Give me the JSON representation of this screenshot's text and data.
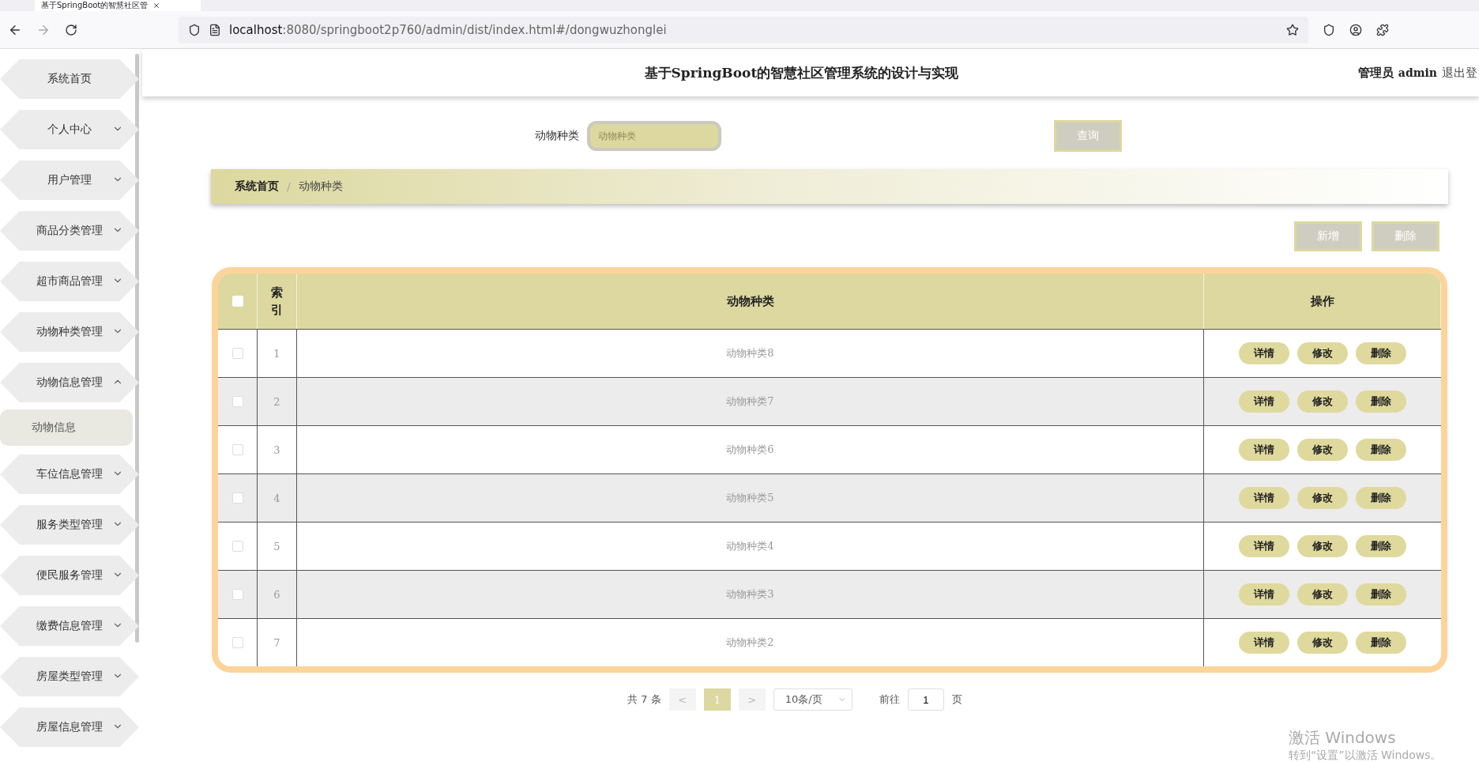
{
  "browser": {
    "tab_title": "基于SpringBoot的智慧社区管",
    "url_host": "localhost",
    "url_path": ":8080/springboot2p760/admin/dist/index.html#/dongwuzhonglei"
  },
  "sidebar": {
    "items": [
      {
        "label": "系统首页",
        "kind": "link"
      },
      {
        "label": "个人中心",
        "kind": "menu",
        "expanded": false
      },
      {
        "label": "用户管理",
        "kind": "menu",
        "expanded": false
      },
      {
        "label": "商品分类管理",
        "kind": "menu",
        "expanded": false
      },
      {
        "label": "超市商品管理",
        "kind": "menu",
        "expanded": false
      },
      {
        "label": "动物种类管理",
        "kind": "menu",
        "expanded": false
      },
      {
        "label": "动物信息管理",
        "kind": "menu",
        "expanded": true,
        "children": [
          {
            "label": "动物信息",
            "selected": true
          }
        ]
      },
      {
        "label": "车位信息管理",
        "kind": "menu",
        "expanded": false
      },
      {
        "label": "服务类型管理",
        "kind": "menu",
        "expanded": false
      },
      {
        "label": "便民服务管理",
        "kind": "menu",
        "expanded": false
      },
      {
        "label": "缴费信息管理",
        "kind": "menu",
        "expanded": false
      },
      {
        "label": "房屋类型管理",
        "kind": "menu",
        "expanded": false
      },
      {
        "label": "房屋信息管理",
        "kind": "menu",
        "expanded": false
      }
    ]
  },
  "header": {
    "title": "基于SpringBoot的智慧社区管理系统的设计与实现",
    "user_role": "管理员",
    "user_name": "admin",
    "logout": "退出登"
  },
  "search": {
    "label": "动物种类",
    "placeholder": "动物种类",
    "button": "查询"
  },
  "breadcrumb": [
    "系统首页",
    "动物种类"
  ],
  "breadcrumb_separator": "/",
  "actions": [
    "新增",
    "删除"
  ],
  "table": {
    "header_checked": false,
    "columns": [
      "索引",
      "动物种类",
      "操作"
    ],
    "rows": [
      {
        "checked": false,
        "index": "1",
        "name": "动物种类8",
        "actions": [
          "详情",
          "修改",
          "删除"
        ]
      },
      {
        "checked": false,
        "index": "2",
        "name": "动物种类7",
        "actions": [
          "详情",
          "修改",
          "删除"
        ]
      },
      {
        "checked": false,
        "index": "3",
        "name": "动物种类6",
        "actions": [
          "详情",
          "修改",
          "删除"
        ]
      },
      {
        "checked": false,
        "index": "4",
        "name": "动物种类5",
        "actions": [
          "详情",
          "修改",
          "删除"
        ]
      },
      {
        "checked": false,
        "index": "5",
        "name": "动物种类4",
        "actions": [
          "详情",
          "修改",
          "删除"
        ]
      },
      {
        "checked": false,
        "index": "6",
        "name": "动物种类3",
        "actions": [
          "详情",
          "修改",
          "删除"
        ]
      },
      {
        "checked": false,
        "index": "7",
        "name": "动物种类2",
        "actions": [
          "详情",
          "修改",
          "删除"
        ]
      }
    ]
  },
  "pagination": {
    "total": "共 7 条",
    "prev": "<",
    "pages": [
      {
        "label": "1",
        "selected": true
      }
    ],
    "next": ">",
    "page_size": "10条/页",
    "goto_label": "前往",
    "goto_value": "1",
    "goto_suffix": "页"
  },
  "os_notice": {
    "title": "激活 Windows",
    "text": "转到“设置”以激活 Windows。"
  }
}
